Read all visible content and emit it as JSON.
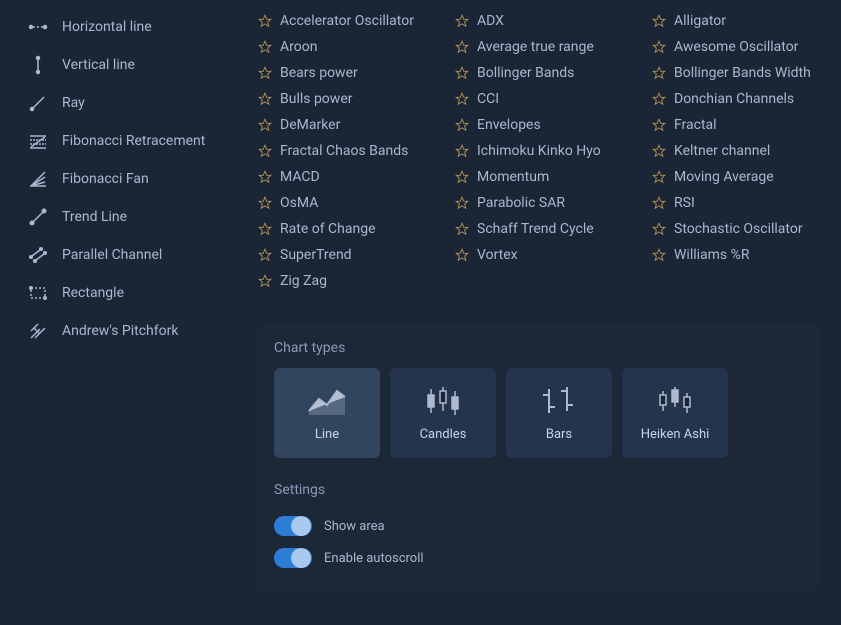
{
  "tools": [
    {
      "id": "horizontal-line",
      "label": "Horizontal line"
    },
    {
      "id": "vertical-line",
      "label": "Vertical line"
    },
    {
      "id": "ray",
      "label": "Ray"
    },
    {
      "id": "fib-retracement",
      "label": "Fibonacci Retracement"
    },
    {
      "id": "fib-fan",
      "label": "Fibonacci Fan"
    },
    {
      "id": "trend-line",
      "label": "Trend Line"
    },
    {
      "id": "parallel-channel",
      "label": "Parallel Channel"
    },
    {
      "id": "rectangle",
      "label": "Rectangle"
    },
    {
      "id": "andrews-pitchfork",
      "label": "Andrew's Pitchfork"
    }
  ],
  "indicators": {
    "col1": [
      "Accelerator Oscillator",
      "Aroon",
      "Bears power",
      "Bulls power",
      "DeMarker",
      "Fractal Chaos Bands",
      "MACD",
      "OsMA",
      "Rate of Change",
      "SuperTrend",
      "Zig Zag"
    ],
    "col2": [
      "ADX",
      "Average true range",
      "Bollinger Bands",
      "CCI",
      "Envelopes",
      "Ichimoku Kinko Hyo",
      "Momentum",
      "Parabolic SAR",
      "Schaff Trend Cycle",
      "Vortex"
    ],
    "col3": [
      "Alligator",
      "Awesome Oscillator",
      "Bollinger Bands Width",
      "Donchian Channels",
      "Fractal",
      "Keltner channel",
      "Moving Average",
      "RSI",
      "Stochastic Oscillator",
      "Williams %R"
    ]
  },
  "chart_types_title": "Chart types",
  "chart_types": [
    {
      "id": "line",
      "label": "Line",
      "selected": true
    },
    {
      "id": "candles",
      "label": "Candles",
      "selected": false
    },
    {
      "id": "bars",
      "label": "Bars",
      "selected": false
    },
    {
      "id": "heiken-ashi",
      "label": "Heiken Ashi",
      "selected": false
    }
  ],
  "settings_title": "Settings",
  "settings": [
    {
      "id": "show-area",
      "label": "Show area",
      "on": true
    },
    {
      "id": "enable-autoscroll",
      "label": "Enable autoscroll",
      "on": true
    }
  ]
}
